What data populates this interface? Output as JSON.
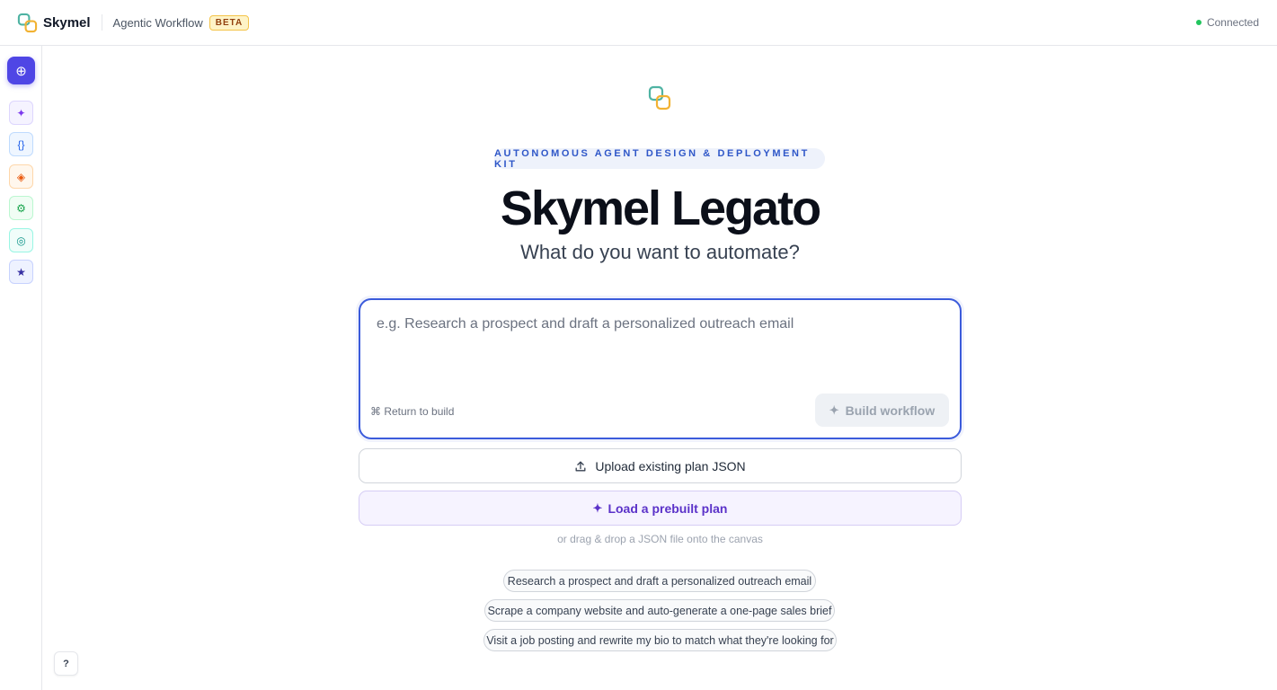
{
  "header": {
    "brand_name": "Skymel",
    "workflow_label": "Agentic Workflow",
    "beta_badge": "BETA",
    "status_text": "Connected",
    "status_color": "#22c55e"
  },
  "sidebar": {
    "items": [
      {
        "icon": "plus-circle-icon",
        "glyph": "⊕",
        "color": "#ffffff",
        "bg": "#4f46e5",
        "border": "#4f46e5"
      },
      {
        "icon": "sparkle-icon",
        "glyph": "✦",
        "color": "#7c3aed",
        "bg": "#f5f3ff",
        "border": "#ddd6fe"
      },
      {
        "icon": "code-braces-icon",
        "glyph": "{}",
        "color": "#2563eb",
        "bg": "#eff6ff",
        "border": "#bfdbfe"
      },
      {
        "icon": "diamond-icon",
        "glyph": "◈",
        "color": "#ea580c",
        "bg": "#fff7ed",
        "border": "#fed7aa"
      },
      {
        "icon": "gear-icon",
        "glyph": "⚙",
        "color": "#16a34a",
        "bg": "#f0fdf4",
        "border": "#bbf7d0"
      },
      {
        "icon": "target-icon",
        "glyph": "◎",
        "color": "#0d9488",
        "bg": "#f0fdfa",
        "border": "#99f6e4"
      },
      {
        "icon": "star-icon",
        "glyph": "★",
        "color": "#3730a3",
        "bg": "#eef2ff",
        "border": "#c7d2fe"
      }
    ],
    "help_label": "?"
  },
  "hero": {
    "kit_label": "AUTONOMOUS AGENT DESIGN & DEPLOYMENT KIT",
    "title": "Skymel Legato",
    "subtitle": "What do you want to automate?"
  },
  "prompt": {
    "placeholder": "e.g. Research a prospect and draft a personalized outreach email",
    "value": "",
    "return_hint": "⌘ Return to build",
    "build_label": "Build workflow"
  },
  "actions": {
    "upload_label": "Upload existing plan JSON",
    "prebuilt_label": "Load a prebuilt plan",
    "drag_hint": "or drag & drop a JSON file onto the canvas"
  },
  "suggestions": [
    "Research a prospect and draft a personalized outreach email",
    "Scrape a company website and auto-generate a one-page sales brief",
    "Visit a job posting and rewrite my bio to match what they're looking for"
  ],
  "colors": {
    "accent": "#3b5bdb",
    "primary_sidebar": "#4f46e5",
    "prebuilt_text": "#5b32c9",
    "kit_text": "#2f57c8"
  }
}
